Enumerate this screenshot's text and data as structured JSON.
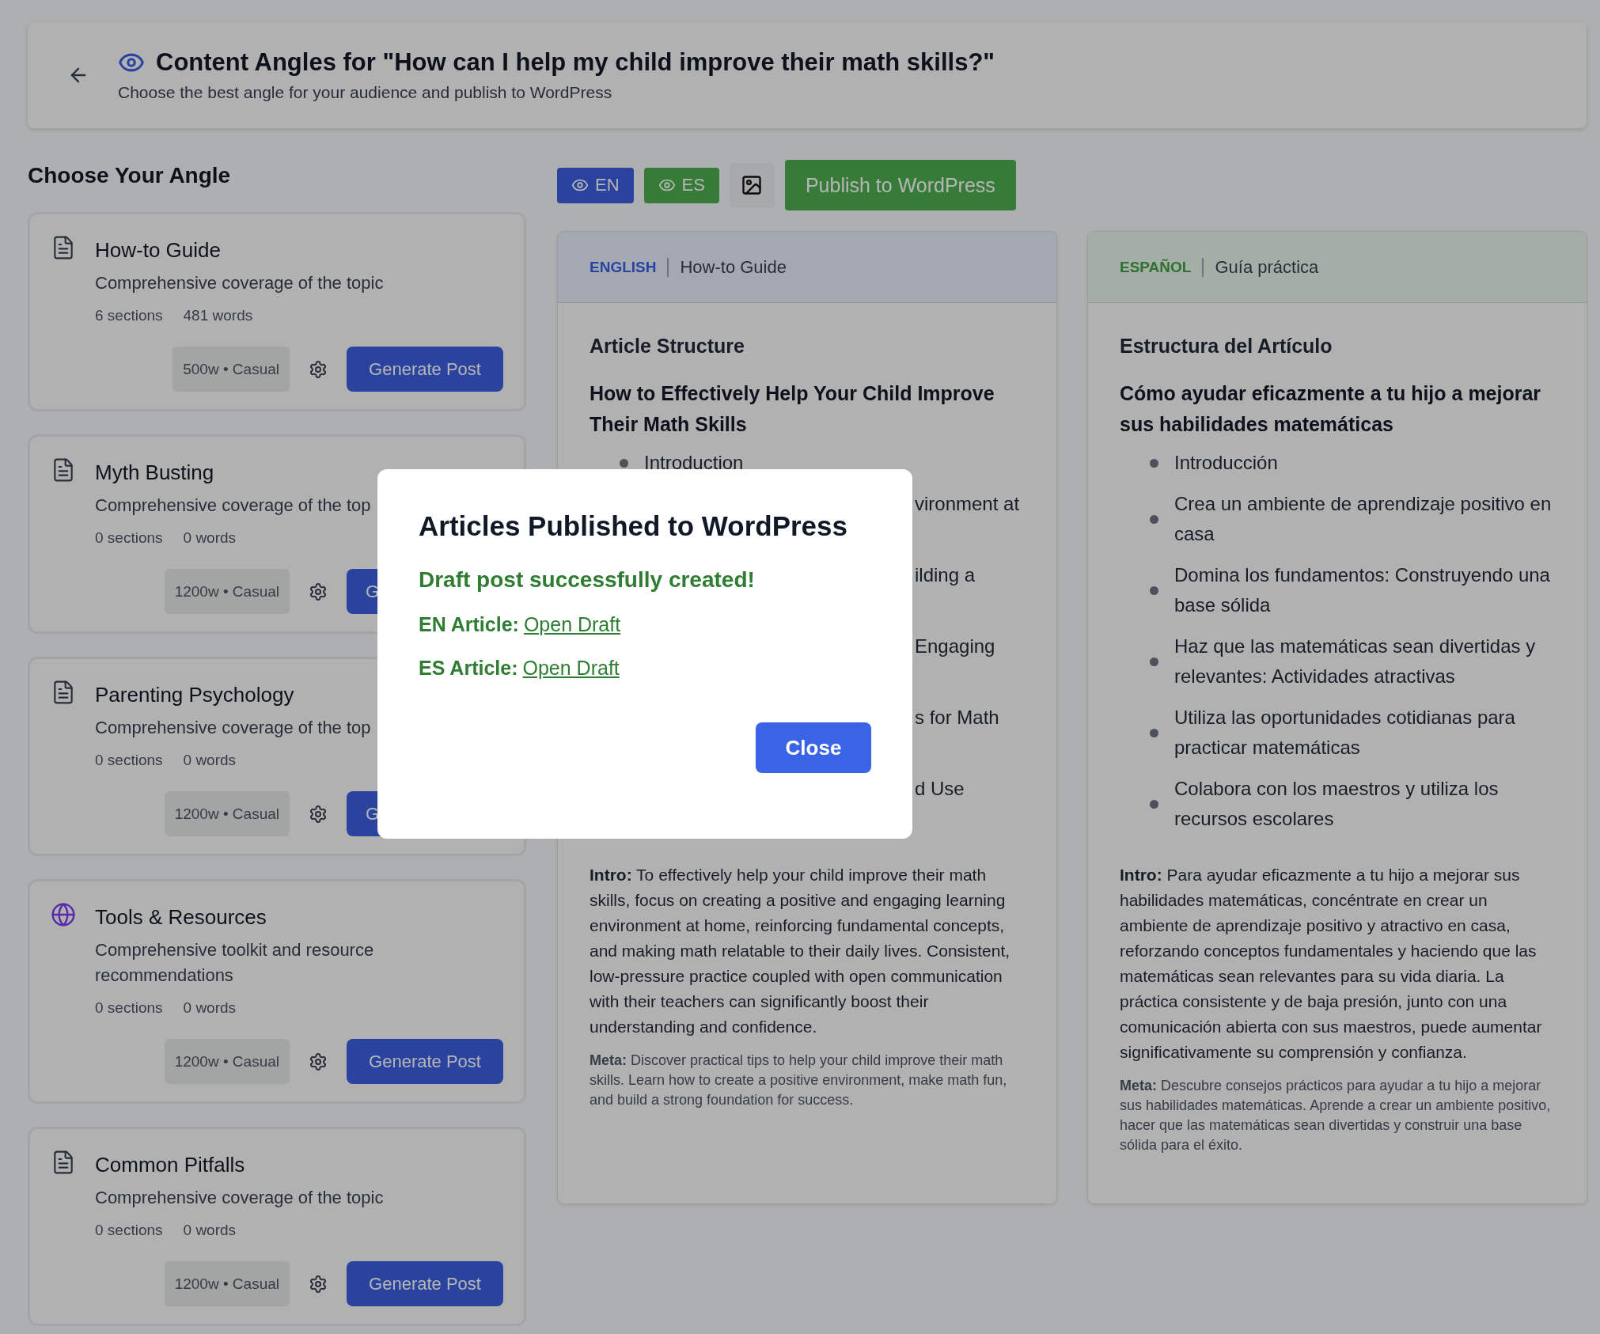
{
  "header": {
    "title": "Content Angles for \"How can I help my child improve their math skills?\"",
    "subtitle": "Choose the best angle for your audience and publish to WordPress"
  },
  "sidebar": {
    "heading": "Choose Your Angle",
    "angles": [
      {
        "kind": "document",
        "title": "How-to Guide",
        "description": "Comprehensive coverage of the topic",
        "sections": "6 sections",
        "words": "481 words",
        "chip": "500w • Casual",
        "button": "Generate Post"
      },
      {
        "kind": "document",
        "title": "Myth Busting",
        "description": "Comprehensive coverage of the top",
        "sections": "0 sections",
        "words": "0 words",
        "chip": "1200w • Casual",
        "button": "G"
      },
      {
        "kind": "document",
        "title": "Parenting Psychology",
        "description": "Comprehensive coverage of the top",
        "sections": "0 sections",
        "words": "0 words",
        "chip": "1200w • Casual",
        "button": "G"
      },
      {
        "kind": "globe",
        "title": "Tools & Resources",
        "description": "Comprehensive toolkit and resource recommendations",
        "sections": "0 sections",
        "words": "0 words",
        "chip": "1200w • Casual",
        "button": "Generate Post"
      },
      {
        "kind": "document",
        "title": "Common Pitfalls",
        "description": "Comprehensive coverage of the topic",
        "sections": "0 sections",
        "words": "0 words",
        "chip": "1200w • Casual",
        "button": "Generate Post"
      }
    ]
  },
  "toolbar": {
    "languages": [
      {
        "label": "EN"
      },
      {
        "label": "ES"
      }
    ],
    "publish": "Publish to WordPress"
  },
  "panels": [
    {
      "language": "ENGLISH",
      "angle": "How-to Guide",
      "structure_heading": "Article Structure",
      "article_title": "How to Effectively Help Your Child Improve Their Math Skills",
      "outline": [
        {
          "kind": "full",
          "text": "Introduction"
        },
        {
          "kind": "fragment",
          "text": "vironment at"
        },
        {
          "kind": "fragment",
          "text": "ilding a"
        },
        {
          "kind": "fragment",
          "text": "Engaging"
        },
        {
          "kind": "fragment",
          "text": "s for Math"
        },
        {
          "kind": "fragment",
          "text": "d Use"
        }
      ],
      "intro": "**Intro:** To effectively help your child improve their math skills, focus on creating a positive and engaging learning environment at home, reinforcing fundamental concepts, and making math relatable to their daily lives. Consistent, low-pressure practice coupled with open communication with their teachers can significantly boost their understanding and confidence.",
      "meta": "**Meta:** Discover practical tips to help your child improve their math skills. Learn how to create a positive environment, make math fun, and build a strong foundation for success."
    },
    {
      "language": "ESPAÑOL",
      "angle": "Guía práctica",
      "structure_heading": "Estructura del Artículo",
      "article_title": "Cómo ayudar eficazmente a tu hijo a mejorar sus habilidades matemáticas",
      "outline": [
        {
          "kind": "full",
          "text": "Introducción"
        },
        {
          "kind": "full",
          "text": "Crea un ambiente de aprendizaje positivo en casa"
        },
        {
          "kind": "full",
          "text": "Domina los fundamentos: Construyendo una base sólida"
        },
        {
          "kind": "full",
          "text": "Haz que las matemáticas sean divertidas y relevantes: Actividades atractivas"
        },
        {
          "kind": "full",
          "text": "Utiliza las oportunidades cotidianas para practicar matemáticas"
        },
        {
          "kind": "full",
          "text": "Colabora con los maestros y utiliza los recursos escolares"
        }
      ],
      "intro": "**Intro:** Para ayudar eficazmente a tu hijo a mejorar sus habilidades matemáticas, concéntrate en crear un ambiente de aprendizaje positivo y atractivo en casa, reforzando conceptos fundamentales y haciendo que las matemáticas sean relevantes para su vida diaria. La práctica consistente y de baja presión, junto con una comunicación abierta con sus maestros, puede aumentar significativamente su comprensión y confianza.",
      "meta": "**Meta:** Descubre consejos prácticos para ayudar a tu hijo a mejorar sus habilidades matemáticas. Aprende a crear un ambiente positivo, hacer que las matemáticas sean divertidas y construir una base sólida para el éxito."
    }
  ],
  "modal": {
    "title": "Articles Published to WordPress",
    "message": "Draft post successfully created!",
    "links": [
      {
        "label": "EN Article:",
        "link": "Open Draft"
      },
      {
        "label": "ES Article:",
        "link": "Open Draft"
      }
    ],
    "button": "Close"
  }
}
